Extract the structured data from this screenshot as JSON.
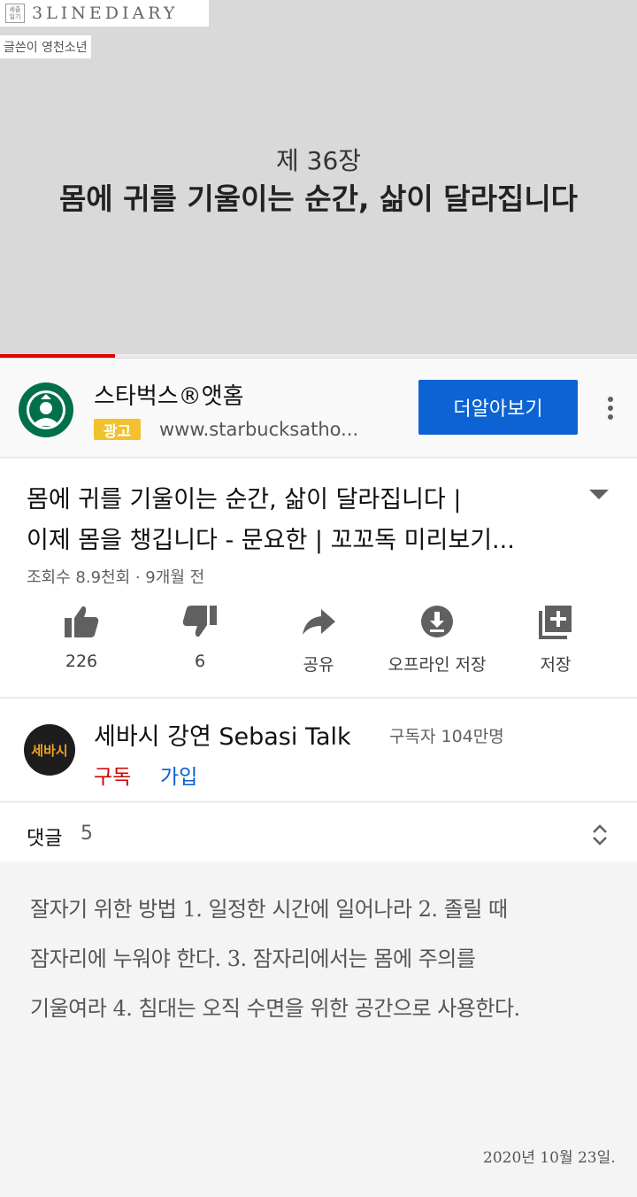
{
  "video": {
    "watermark": "3LINEDIARY",
    "stamp": "세줄\n일기",
    "author": "글쓴이 영천소년",
    "chapter": "제 36장",
    "title": "몸에 귀를 기울이는 순간, 삶이 달라집니다",
    "progress": 0.18,
    "progress_color": "#e00000"
  },
  "ad": {
    "title": "스타벅스®앳홈",
    "badge": "광고",
    "url": "www.starbucksatho...",
    "cta": "더알아보기",
    "cta_color": "#0d63d3",
    "logo_icon": "starbucks-logo",
    "more_icon": "more-vert-icon"
  },
  "video_info": {
    "title_line1": "몸에 귀를 기울이는 순간, 삶이 달라집니다 |",
    "title_line2": "이제 몸을 챙깁니다 - 문요한 | 꼬꼬독 미리보기...",
    "meta": "조회수 8.9천회 · 9개월 전",
    "actions": [
      {
        "icon": "thumbs-up-icon",
        "label": "226"
      },
      {
        "icon": "thumbs-down-icon",
        "label": "6"
      },
      {
        "icon": "share-icon",
        "label": "공유"
      },
      {
        "icon": "download-icon",
        "label": "오프라인 저장"
      },
      {
        "icon": "save-playlist-icon",
        "label": "저장"
      }
    ]
  },
  "channel": {
    "avatar_text": "세바시",
    "name": "세바시 강연 Sebasi Talk",
    "subscribers": "구독자 104만명",
    "subscribe": "구독",
    "join": "가입"
  },
  "comments": {
    "label": "댓글",
    "count": "5"
  },
  "note": {
    "lines": [
      "잘자기 위한 방법 1. 일정한 시간에 일어나라 2. 졸릴 때",
      "잠자리에 누워야 한다. 3. 잠자리에서는 몸에 주의를",
      "기울여라 4. 침대는 오직 수면을 위한 공간으로 사용한다."
    ],
    "date": "2020년 10월 23일."
  }
}
